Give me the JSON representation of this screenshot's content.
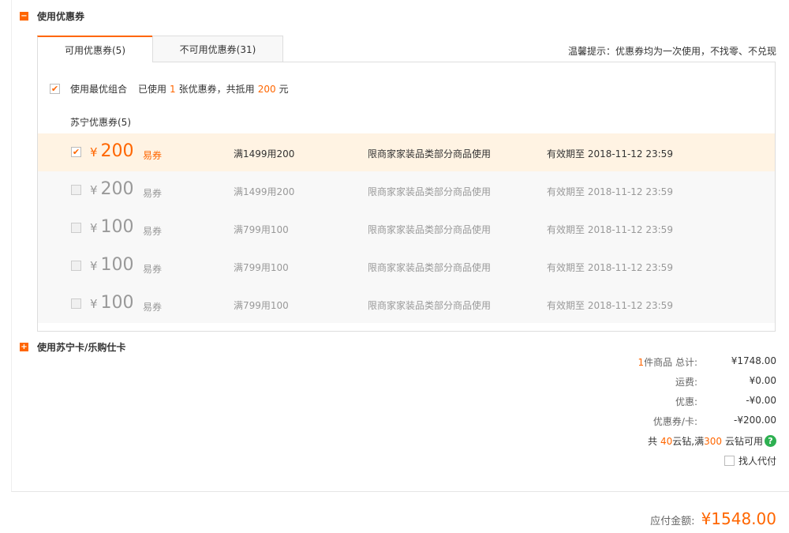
{
  "coupon_section": {
    "toggle_icon": "−",
    "title": "使用优惠券",
    "tabs": [
      {
        "label": "可用优惠券(5)",
        "active": true
      },
      {
        "label": "不可用优惠券(31)",
        "active": false
      }
    ],
    "tip": "温馨提示：优惠券均为一次使用，不找零、不兑现",
    "best_combo": {
      "label": "使用最优组合",
      "used_prefix": "已使用",
      "used_count": "1",
      "used_mid": "张优惠券，共抵用",
      "used_amount": "200",
      "used_unit": "元",
      "checked": true
    },
    "group_title": "苏宁优惠券(5)",
    "coupons": [
      {
        "currency": "¥",
        "amount": "200",
        "kind": "易券",
        "condition": "满1499用200",
        "scope": "限商家家装品类部分商品使用",
        "expiry": "有效期至 2018-11-12 23:59",
        "checked": true
      },
      {
        "currency": "¥",
        "amount": "200",
        "kind": "易券",
        "condition": "满1499用200",
        "scope": "限商家家装品类部分商品使用",
        "expiry": "有效期至 2018-11-12 23:59",
        "checked": false
      },
      {
        "currency": "¥",
        "amount": "100",
        "kind": "易券",
        "condition": "满799用100",
        "scope": "限商家家装品类部分商品使用",
        "expiry": "有效期至 2018-11-12 23:59",
        "checked": false
      },
      {
        "currency": "¥",
        "amount": "100",
        "kind": "易券",
        "condition": "满799用100",
        "scope": "限商家家装品类部分商品使用",
        "expiry": "有效期至 2018-11-12 23:59",
        "checked": false
      },
      {
        "currency": "¥",
        "amount": "100",
        "kind": "易券",
        "condition": "满799用100",
        "scope": "限商家家装品类部分商品使用",
        "expiry": "有效期至 2018-11-12 23:59",
        "checked": false
      }
    ]
  },
  "card_section": {
    "toggle_icon": "+",
    "title": "使用苏宁卡/乐购仕卡"
  },
  "summary": {
    "items_count": "1",
    "items_label": "件商品 总计:",
    "items_total": "¥1748.00",
    "shipping_label": "运费:",
    "shipping_value": "¥0.00",
    "discount_label": "优惠:",
    "discount_value": "-¥0.00",
    "coupon_label": "优惠券/卡:",
    "coupon_value": "-¥200.00",
    "diamond_prefix": "共",
    "diamond_count": "40",
    "diamond_mid": "云钻,满",
    "diamond_threshold": "300",
    "diamond_suffix": "云钻可用",
    "help_icon": "?",
    "pay_for_me_label": "找人代付"
  },
  "total": {
    "label": "应付金额:",
    "value": "¥1548.00"
  },
  "colors": {
    "accent": "#ff6600",
    "selected_row": "#fff3e3",
    "help": "#2eb051"
  }
}
